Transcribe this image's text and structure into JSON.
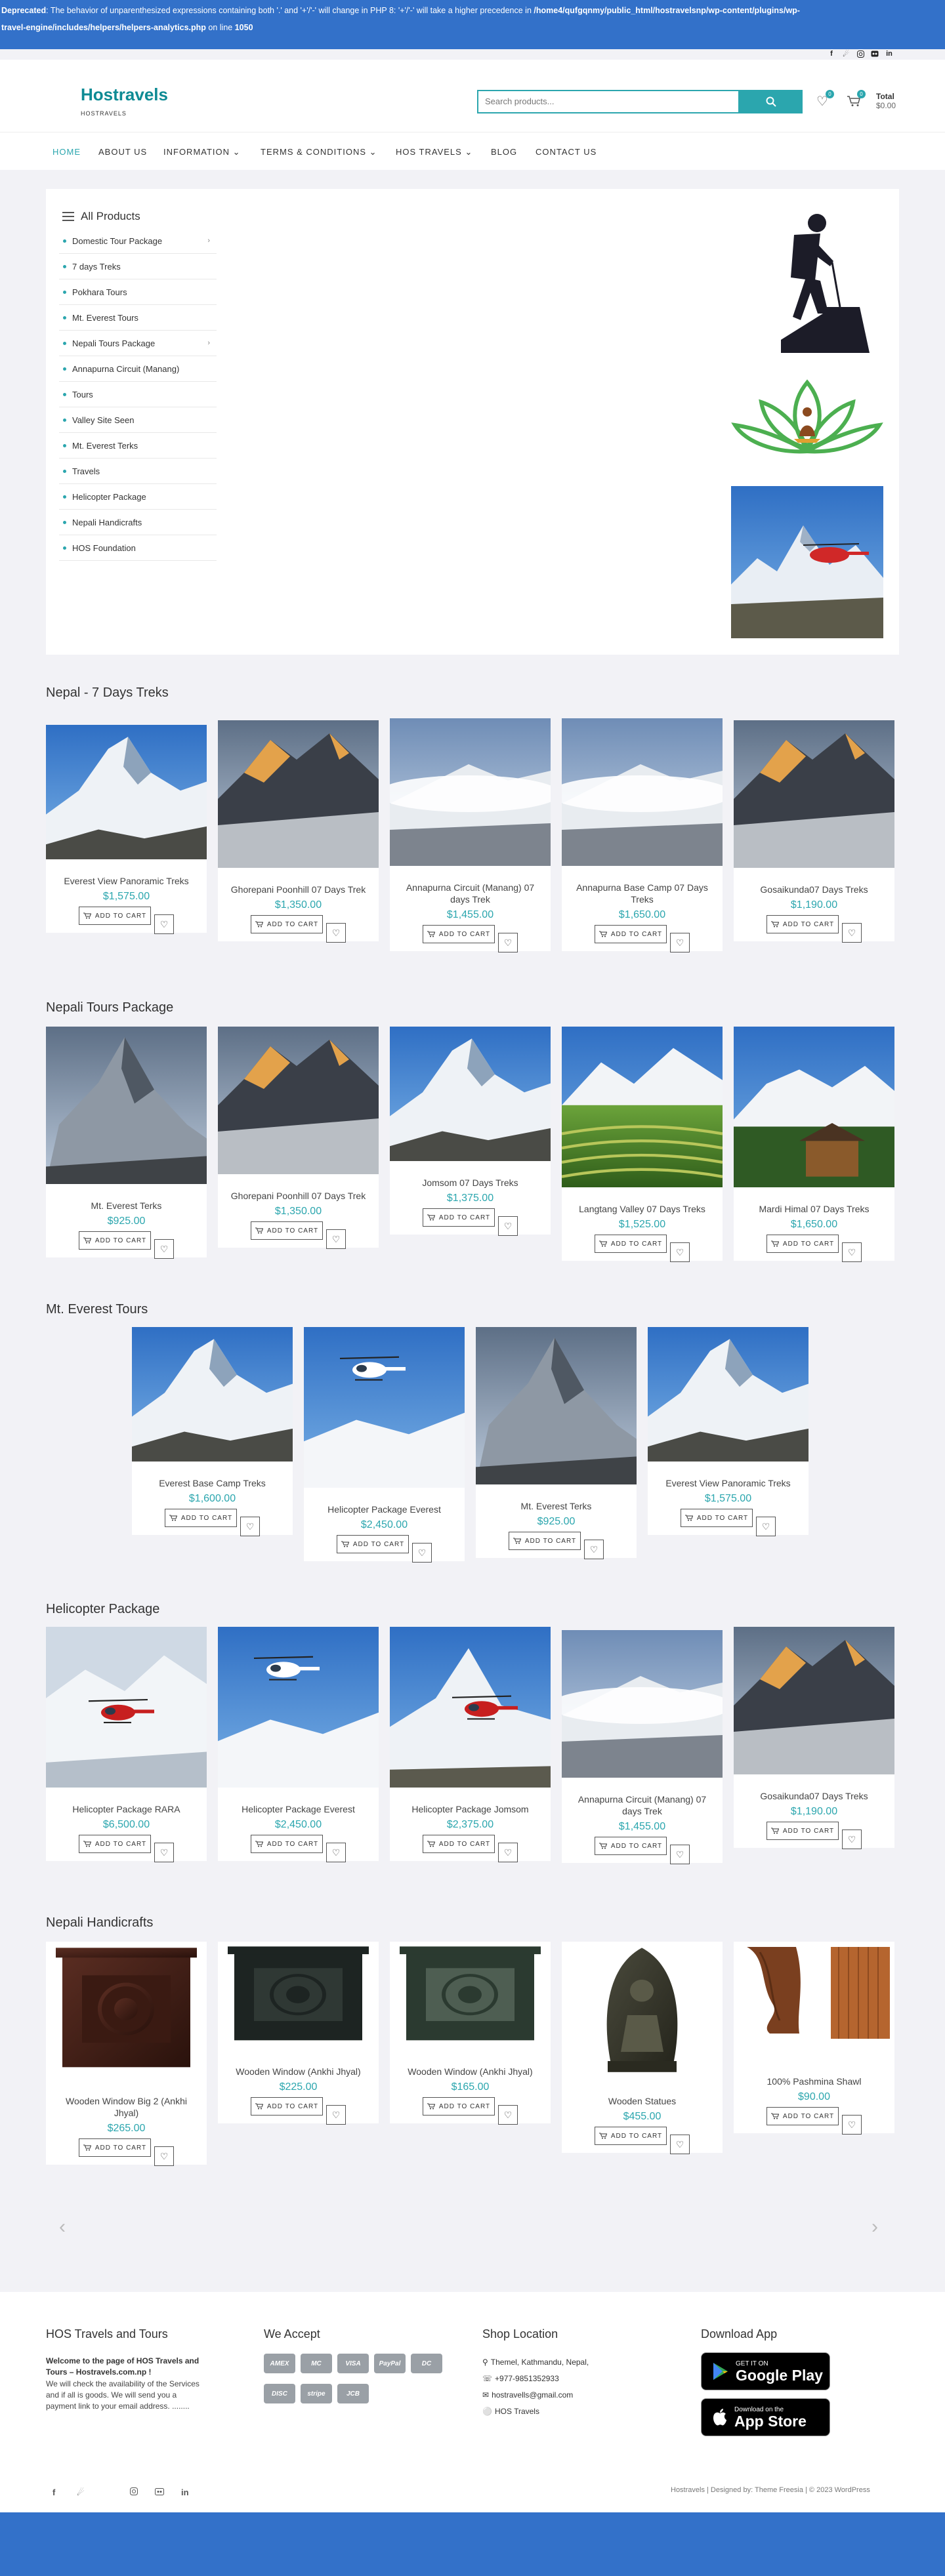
{
  "deprecated": {
    "label": "Deprecated",
    "message": ": The behavior of unparenthesized expressions containing both '.' and '+'/'-' will change in PHP 8: '+'/'-' will take a higher precedence in",
    "path_line1": "/home4/qufgqnmy/public_html/hostravelsnp/wp-content/plugins/wp-",
    "path_line2": "travel-engine/includes/helpers/helpers-analytics.php",
    "on_line": "on line",
    "line_no": "1050"
  },
  "header": {
    "site_title": "Hostravels",
    "tagline": "HOSTRAVELS",
    "search_placeholder": "Search products...",
    "wishlist_count": "0",
    "cart_count": "0",
    "total_label": "Total",
    "total_value": "$0.00"
  },
  "nav": [
    {
      "label": "HOME"
    },
    {
      "label": "ABOUT US"
    },
    {
      "label": "INFORMATION"
    },
    {
      "label": "TERMS & CONDITIONS"
    },
    {
      "label": "HOS TRAVELS"
    },
    {
      "label": "BLOG"
    },
    {
      "label": "CONTACT US"
    }
  ],
  "categories": {
    "title": "All Products",
    "items": [
      {
        "label": "Domestic Tour Package",
        "has_children": true
      },
      {
        "label": "7 days Treks"
      },
      {
        "label": "Pokhara Tours"
      },
      {
        "label": "Mt. Everest Tours"
      },
      {
        "label": "Nepali Tours Package",
        "has_children": true
      },
      {
        "label": "Annapurna Circuit (Manang)"
      },
      {
        "label": "Tours"
      },
      {
        "label": "Valley Site Seen"
      },
      {
        "label": "Mt. Everest Terks"
      },
      {
        "label": "Travels"
      },
      {
        "label": "Helicopter Package"
      },
      {
        "label": "Nepali Handicrafts"
      },
      {
        "label": "HOS Foundation"
      }
    ]
  },
  "common": {
    "add_to_cart": "ADD TO CART"
  },
  "sections": [
    {
      "title": "Nepal - 7 Days Treks",
      "products": [
        {
          "name": "Everest View Panoramic Treks",
          "price": "$1,575.00",
          "img": "peak-blue"
        },
        {
          "name": "Ghorepani Poonhill 07 Days Trek",
          "price": "$1,350.00",
          "img": "peak-sunset"
        },
        {
          "name": "Annapurna Circuit (Manang) 07 days Trek",
          "price": "$1,455.00",
          "img": "peak-clouds"
        },
        {
          "name": "Annapurna Base Camp 07 Days Treks",
          "price": "$1,650.00",
          "img": "peak-clouds"
        },
        {
          "name": "Gosaikunda07 Days Treks",
          "price": "$1,190.00",
          "img": "peak-sunset"
        }
      ]
    },
    {
      "title": "Nepali Tours Package",
      "products": [
        {
          "name": "Mt. Everest Terks",
          "price": "$925.00",
          "img": "peak-dark"
        },
        {
          "name": "Ghorepani Poonhill 07 Days Trek",
          "price": "$1,350.00",
          "img": "peak-sunset"
        },
        {
          "name": "Jomsom 07 Days Treks",
          "price": "$1,375.00",
          "img": "peak-blue"
        },
        {
          "name": "Langtang Valley 07 Days Treks",
          "price": "$1,525.00",
          "img": "valley"
        },
        {
          "name": "Mardi Himal 07 Days Treks",
          "price": "$1,650.00",
          "img": "village"
        }
      ]
    },
    {
      "title": "Mt. Everest Tours",
      "products": [
        {
          "name": "Everest Base Camp Treks",
          "price": "$1,600.00",
          "img": "peak-blue"
        },
        {
          "name": "Helicopter Package Everest",
          "price": "$2,450.00",
          "img": "heli-white"
        },
        {
          "name": "Mt. Everest Terks",
          "price": "$925.00",
          "img": "peak-dark"
        },
        {
          "name": "Everest View Panoramic Treks",
          "price": "$1,575.00",
          "img": "peak-blue"
        }
      ]
    },
    {
      "title": "Helicopter Package",
      "products": [
        {
          "name": "Helicopter Package RARA",
          "price": "$6,500.00",
          "img": "heli-red-snow"
        },
        {
          "name": "Helicopter Package Everest",
          "price": "$2,450.00",
          "img": "heli-white"
        },
        {
          "name": "Helicopter Package Jomsom",
          "price": "$2,375.00",
          "img": "heli-red"
        },
        {
          "name": "Annapurna Circuit (Manang) 07 days Trek",
          "price": "$1,455.00",
          "img": "peak-clouds"
        },
        {
          "name": "Gosaikunda07 Days Treks",
          "price": "$1,190.00",
          "img": "peak-sunset"
        }
      ]
    },
    {
      "title": "Nepali Handicrafts",
      "products": [
        {
          "name": "Wooden Window Big 2 (Ankhi Jhyal)",
          "price": "$265.00",
          "img": "window-brown"
        },
        {
          "name": "Wooden Window (Ankhi Jhyal)",
          "price": "$225.00",
          "img": "window-dark"
        },
        {
          "name": "Wooden Window (Ankhi Jhyal)",
          "price": "$165.00",
          "img": "window-green"
        },
        {
          "name": "Wooden Statues",
          "price": "$455.00",
          "img": "statue"
        },
        {
          "name": "100% Pashmina Shawl",
          "price": "$90.00",
          "img": "shawl"
        }
      ]
    }
  ],
  "footer": {
    "about_title": "HOS Travels and Tours",
    "about_bold": "Welcome to the page of HOS Travels and Tours – Hostravels.com.np !",
    "about_text": "We will check the availability of the Services and if all is goods. We will send you a payment link to your email address. ........",
    "accept_title": "We Accept",
    "payments": [
      "AMEX",
      "MC",
      "VISA",
      "PayPal",
      "DC",
      "DISC",
      "stripe",
      "JCB"
    ],
    "location_title": "Shop Location",
    "address": "Themel, Kathmandu, Nepal,",
    "phone": "+977-9851352933",
    "email": "hostravells@gmail.com",
    "company": "HOS Travels",
    "app_title": "Download App",
    "gp_small": "GET IT ON",
    "gp_big": "Google Play",
    "as_small": "Download on the",
    "as_big": "App Store",
    "copyright": "Hostravels | Designed by: Theme Freesia | © 2023 WordPress"
  }
}
